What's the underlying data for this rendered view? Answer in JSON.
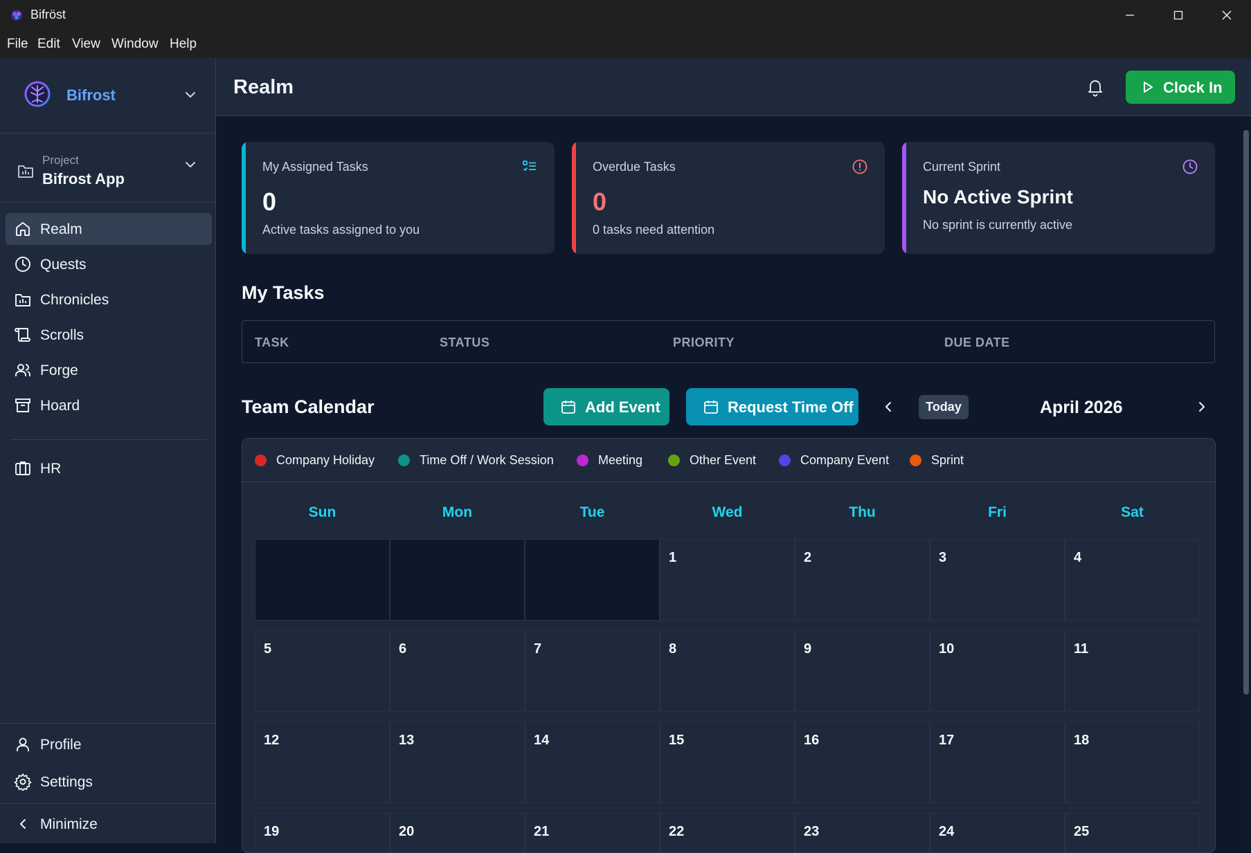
{
  "window": {
    "title": "Bifröst"
  },
  "menu": [
    "File",
    "Edit",
    "View",
    "Window",
    "Help"
  ],
  "sidebar": {
    "brand": "Bifrost",
    "project_label": "Project",
    "project_name": "Bifrost App",
    "items": [
      {
        "label": "Realm",
        "icon": "home-icon",
        "active": true
      },
      {
        "label": "Quests",
        "icon": "clock-icon"
      },
      {
        "label": "Chronicles",
        "icon": "chart-folder-icon"
      },
      {
        "label": "Scrolls",
        "icon": "scroll-icon"
      },
      {
        "label": "Forge",
        "icon": "users-icon"
      },
      {
        "label": "Hoard",
        "icon": "archive-icon"
      }
    ],
    "hr": "HR",
    "profile": "Profile",
    "settings": "Settings",
    "minimize": "Minimize"
  },
  "header": {
    "title": "Realm",
    "clock_in": "Clock In"
  },
  "cards": {
    "assigned": {
      "title": "My Assigned Tasks",
      "value": "0",
      "sub": "Active tasks assigned to you",
      "accent": "#06b6d4"
    },
    "overdue": {
      "title": "Overdue Tasks",
      "value": "0",
      "sub": "0 tasks need attention",
      "accent": "#ef4444"
    },
    "sprint": {
      "title": "Current Sprint",
      "headline": "No Active Sprint",
      "sub": "No sprint is currently active",
      "accent": "#a855f7"
    }
  },
  "my_tasks": {
    "title": "My Tasks",
    "columns": [
      "TASK",
      "STATUS",
      "PRIORITY",
      "DUE DATE"
    ]
  },
  "calendar": {
    "title": "Team Calendar",
    "add_event": "Add Event",
    "request_time_off": "Request Time Off",
    "today": "Today",
    "month": "April 2026",
    "legend": [
      {
        "label": "Company Holiday",
        "color": "#dc2626"
      },
      {
        "label": "Time Off / Work Session",
        "color": "#0d9488"
      },
      {
        "label": "Meeting",
        "color": "#c026d3"
      },
      {
        "label": "Other Event",
        "color": "#65a30d"
      },
      {
        "label": "Company Event",
        "color": "#4f46e5"
      },
      {
        "label": "Sprint",
        "color": "#ea580c"
      }
    ],
    "weekdays": [
      "Sun",
      "Mon",
      "Tue",
      "Wed",
      "Thu",
      "Fri",
      "Sat"
    ],
    "weeks": [
      [
        "",
        "",
        "",
        "1",
        "2",
        "3",
        "4"
      ],
      [
        "5",
        "6",
        "7",
        "8",
        "9",
        "10",
        "11"
      ],
      [
        "12",
        "13",
        "14",
        "15",
        "16",
        "17",
        "18"
      ],
      [
        "19",
        "20",
        "21",
        "22",
        "23",
        "24",
        "25"
      ]
    ]
  }
}
